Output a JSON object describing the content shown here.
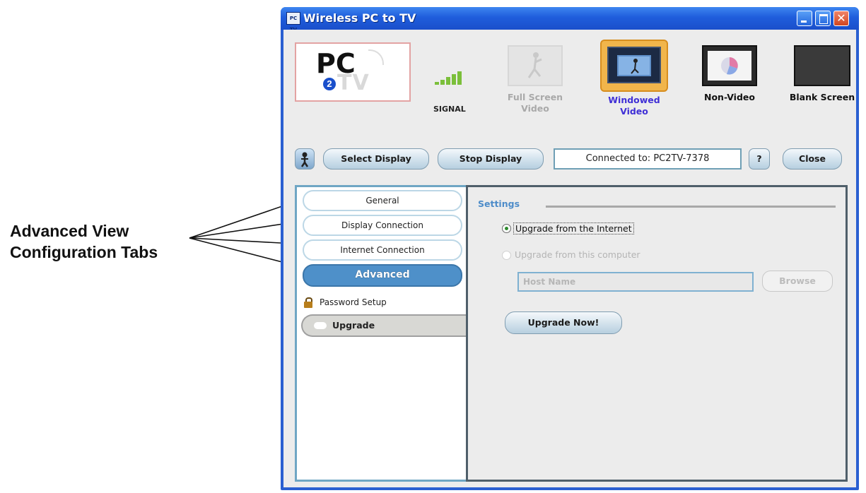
{
  "callout": {
    "line1": "Advanced View",
    "line2": "Configuration Tabs"
  },
  "window": {
    "title": "Wireless PC to TV",
    "icon_text": "PC TV"
  },
  "logo": {
    "pc": "PC",
    "num": "2",
    "tv": "TV"
  },
  "signal": {
    "label": "SIGNAL",
    "bars": 5
  },
  "modes": {
    "full_screen": {
      "line1": "Full Screen",
      "line2": "Video",
      "state": "disabled"
    },
    "windowed": {
      "line1": "Windowed",
      "line2": "Video",
      "state": "selected"
    },
    "non_video": {
      "line1": "Non-Video"
    },
    "blank": {
      "line1": "Blank Screen"
    }
  },
  "toolbar": {
    "select_display": "Select Display",
    "stop_display": "Stop Display",
    "status": "Connected to: PC2TV-7378",
    "help_icon": "?",
    "close": "Close"
  },
  "tabs": [
    {
      "label": "General"
    },
    {
      "label": "Display Connection"
    },
    {
      "label": "Internet Connection"
    },
    {
      "label": "Advanced",
      "active": true
    }
  ],
  "advanced_items": {
    "password_setup": "Password Setup",
    "upgrade": "Upgrade"
  },
  "settings": {
    "legend": "Settings",
    "radio_internet": "Upgrade from the Internet",
    "radio_computer": "Upgrade from this computer",
    "host_placeholder": "Host Name",
    "browse": "Browse",
    "upgrade_now": "Upgrade Now!"
  },
  "colors": {
    "titlebar": "#1f5ddc",
    "selected_mode_label": "#3f2fd6",
    "active_tab": "#4e90c9",
    "settings_legend": "#4d8cc9"
  }
}
